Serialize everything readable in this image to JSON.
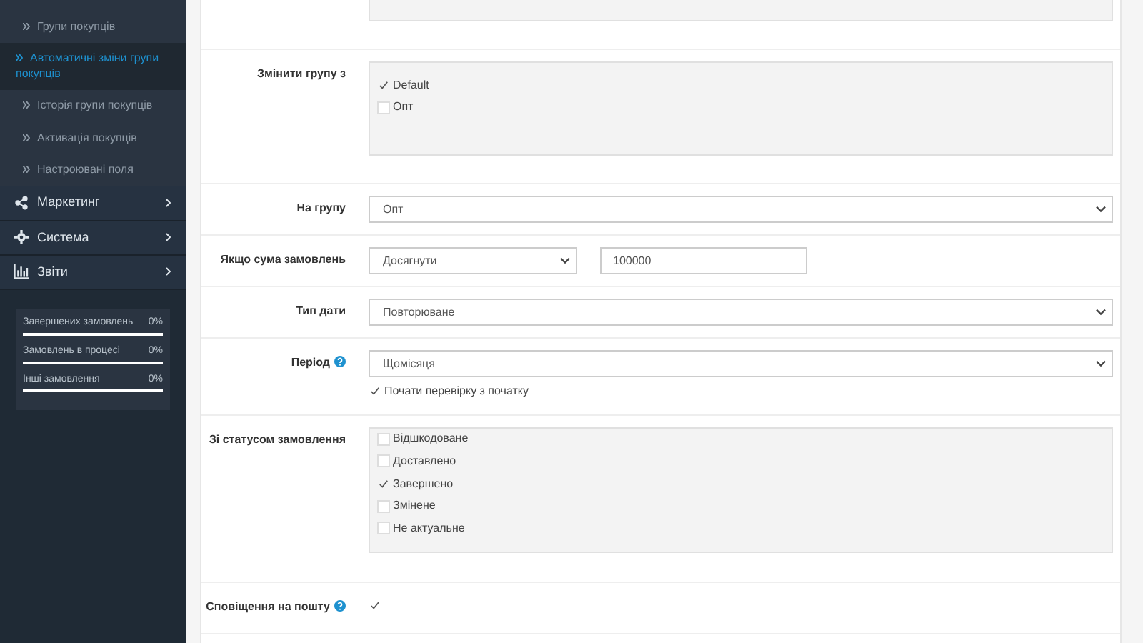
{
  "sidebar": {
    "submenu": [
      {
        "label": "Групи покупців",
        "selected": false
      },
      {
        "label": "Автоматичні зміни групи покупців",
        "selected": true
      },
      {
        "label": "Історія групи покупців",
        "selected": false
      },
      {
        "label": "Активація покупців",
        "selected": false
      },
      {
        "label": "Настроювані поля",
        "selected": false
      }
    ],
    "menu": [
      {
        "label": "Маркетинг"
      },
      {
        "label": "Система"
      },
      {
        "label": "Звіти"
      }
    ],
    "stats": [
      {
        "label": "Завершених замовлень",
        "value": "0%"
      },
      {
        "label": "Замовлень в процесі",
        "value": "0%"
      },
      {
        "label": "Інші замовлення",
        "value": "0%"
      }
    ]
  },
  "form": [
    {
      "kind": "blank"
    },
    {
      "kind": "checklist",
      "label": "Змінити групу з",
      "options": [
        {
          "label": "Default",
          "checked": true
        },
        {
          "label": "Опт",
          "checked": false
        }
      ]
    },
    {
      "kind": "select",
      "label": "На групу",
      "value": "Опт"
    },
    {
      "kind": "pair",
      "label": "Якщо сума замовлень",
      "value": "Досягнути",
      "input": "100000"
    },
    {
      "kind": "select",
      "label": "Тип дати",
      "value": "Повторюване"
    },
    {
      "kind": "select",
      "label": "Період",
      "help": true,
      "value": "Щомісяця",
      "check": {
        "label": "Почати перевірку з початку",
        "checked": true
      }
    },
    {
      "kind": "checklist",
      "label": "Зі статусом замовлення",
      "options": [
        {
          "label": "Відшкодоване",
          "checked": false
        },
        {
          "label": "Доставлено",
          "checked": false
        },
        {
          "label": "Завершено",
          "checked": true
        },
        {
          "label": "Змінене",
          "checked": false
        },
        {
          "label": "Не актуальне",
          "checked": false
        }
      ]
    },
    {
      "kind": "toggle",
      "label": "Сповіщення на пошту",
      "help": true,
      "checked": true
    }
  ]
}
